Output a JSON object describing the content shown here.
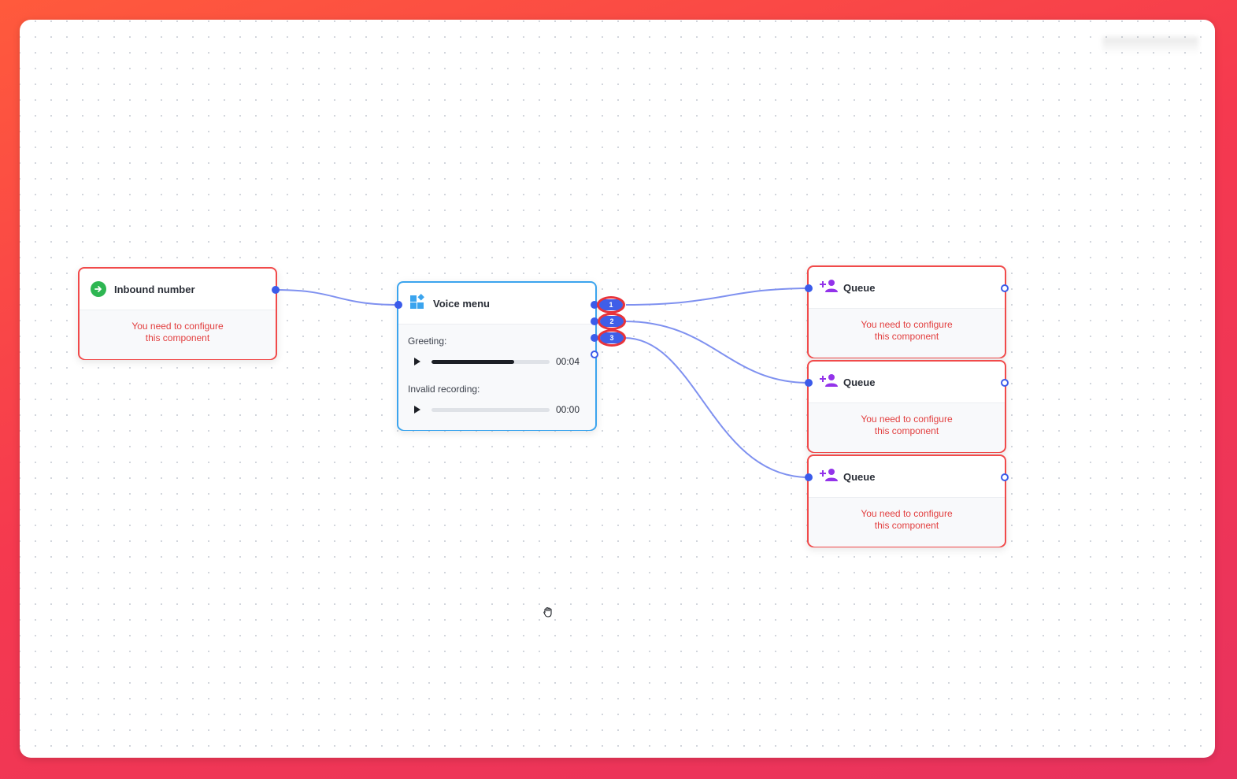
{
  "colors": {
    "accent": "#3b5bea",
    "error": "#e23e3e",
    "node_error_border": "#f14a4a",
    "node_selected_border": "#3ba4ee",
    "edge": "#7f91f0",
    "inbound_icon": "#2eb652",
    "queue_icon": "#9333ea",
    "voice_menu_icon": "#3ba4ee"
  },
  "nodes": {
    "inbound": {
      "title": "Inbound number",
      "icon": "arrow-right-circle-icon",
      "warning_line1": "You need to configure",
      "warning_line2": "this component"
    },
    "voice_menu": {
      "title": "Voice menu",
      "icon": "widgets-icon",
      "greeting_label": "Greeting:",
      "greeting_time": "00:04",
      "greeting_progress": 0.7,
      "invalid_label": "Invalid recording:",
      "invalid_time": "00:00",
      "invalid_progress": 0,
      "options": [
        "1",
        "2",
        "3"
      ]
    },
    "queues": [
      {
        "title": "Queue",
        "icon": "add-person-icon",
        "warning_line1": "You need to configure",
        "warning_line2": "this component"
      },
      {
        "title": "Queue",
        "icon": "add-person-icon",
        "warning_line1": "You need to configure",
        "warning_line2": "this component"
      },
      {
        "title": "Queue",
        "icon": "add-person-icon",
        "warning_line1": "You need to configure",
        "warning_line2": "this component"
      }
    ]
  },
  "cursor": "grab-hand-icon"
}
